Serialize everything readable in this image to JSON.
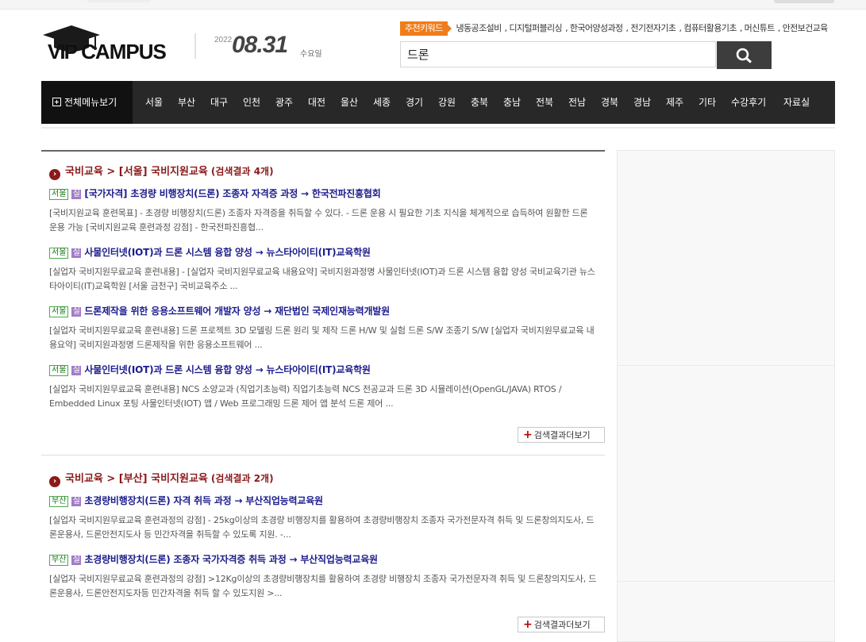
{
  "header": {
    "logo": {
      "vip": "VIP",
      "campus": "CAMPUS"
    },
    "date": {
      "year": "2022",
      "month_day": "08.31",
      "weekday": "수요일"
    },
    "keywords": {
      "badge": "추천키워드",
      "items": [
        "냉동공조설비",
        "디지털퍼블리싱",
        "한국어양성과정",
        "전기전자기초",
        "컴퓨터활용기초",
        "머신튜트",
        "안전보건교육"
      ]
    },
    "search": {
      "value": "드론"
    }
  },
  "nav": {
    "all_menu": "전체메뉴보기",
    "items": [
      "서울",
      "부산",
      "대구",
      "인천",
      "광주",
      "대전",
      "울산",
      "세종",
      "경기",
      "강원",
      "충북",
      "충남",
      "전북",
      "전남",
      "경북",
      "경남",
      "제주",
      "기타",
      "수강후기",
      "자료실"
    ]
  },
  "sections": [
    {
      "bullet": "›",
      "title": "국비교육 > [서울] 국비지원교육",
      "count": "(검색결과 4개)",
      "more": "검색결과더보기",
      "results": [
        {
          "region": "서울",
          "type": "실",
          "title": "[국가자격] 초경량 비행장치(드론) 조종자 자격증 과정 → 한국전파진흥협회",
          "desc": "[국비지원교육 훈련목표] - 초경량 비행장치(드론) 조종자 자격증을 취득할 수 있다. - 드론 운용 시 필요한 기초 지식을 체계적으로 습득하여 원활한 드론 운용 가능 [국비지원교육 훈련과정 강점] - 한국전파진흥협..."
        },
        {
          "region": "서울",
          "type": "실",
          "title": "사물인터넷(IOT)과 드론 시스템 융합 양성 → 뉴스타아이티(IT)교육학원",
          "desc": "[실업자 국비지원무료교육 훈련내용] - [실업자 국비지원무료교육 내용요약] 국비지원과정명 사물인터넷(IOT)과 드론 시스템 융합 양성 국비교육기관 뉴스타아이티(IT)교육학원 [서울 금천구] 국비교육주소 ..."
        },
        {
          "region": "서울",
          "type": "실",
          "title": "드론제작을 위한 응용소프트웨어 개발자 양성 → 재단법인 국제인재능력개발원",
          "desc": "[실업자 국비지원무료교육 훈련내용] 드론 프로젝트 3D 모델링 드론 원리 및 제작 드론 H/W 및 실험 드론 S/W 조종기 S/W [실업자 국비지원무료교육 내용요약] 국비지원과정명 드론제작을 위한 응용소프트웨어 ..."
        },
        {
          "region": "서울",
          "type": "실",
          "title": "사물인터넷(IOT)과 드론 시스템 융합 양성 → 뉴스타아이티(IT)교육학원",
          "desc": "[실업자 국비지원무료교육 훈련내용] NCS 소양교과 (직업기초능력) 직업기초능력 NCS 전공교과 드론 3D 시뮬레이션(OpenGL/JAVA) RTOS / Embedded Linux 포팅 사물인터넷(IOT) 앱 / Web 프로그래밍 드론 제어 앱 분석 드론 제어 ..."
        }
      ]
    },
    {
      "bullet": "›",
      "title": "국비교육 > [부산] 국비지원교육",
      "count": "(검색결과 2개)",
      "more": "검색결과더보기",
      "results": [
        {
          "region": "부산",
          "type": "실",
          "title": "초경량비행장치(드론) 자격 취득 과정 → 부산직업능력교육원",
          "desc": "[실업자 국비지원무료교육 훈련과정의 강점] - 25kg이상의 초경량 비행장치를 활용하여 초경량비행장치 조종자 국가전문자격 취득 및 드론창의지도사, 드론운용사, 드론안전지도사 등 민간자격을 취득할 수 있도록 지원. -..."
        },
        {
          "region": "부산",
          "type": "실",
          "title": "초경량비행장치(드론) 조종자 국가자격증 취득 과정 → 부산직업능력교육원",
          "desc": "[실업자 국비지원무료교육 훈련과정의 강점] >12Kg이상의 초경량비행장치를 활용하여 초경량 비행장치 조종자 국가전문자격 취득 및 드론창의지도사, 드론운용사, 드론안전지도자등 민간자격을 취득 할 수 있도지원 >..."
        }
      ]
    }
  ],
  "colors": {
    "nav_bg": "#282828",
    "nav_menu_bg": "#111111",
    "keyword_badge": "#f07d1b",
    "section_title": "#8b1a1a",
    "result_title": "#1c1c8c",
    "region_tag": "#4caa4c",
    "type_tag": "#a37cc8"
  }
}
